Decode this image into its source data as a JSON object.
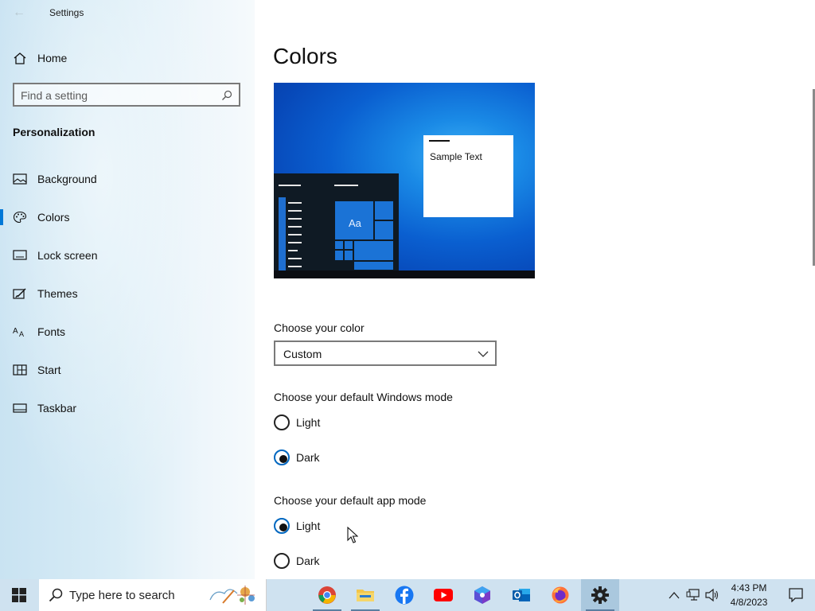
{
  "window": {
    "app_title": "Settings",
    "back_glyph": "←"
  },
  "sidebar": {
    "home_label": "Home",
    "search_placeholder": "Find a setting",
    "section_title": "Personalization",
    "items": [
      {
        "label": "Background",
        "icon": "image-icon"
      },
      {
        "label": "Colors",
        "icon": "palette-icon",
        "selected": true
      },
      {
        "label": "Lock screen",
        "icon": "lock-screen-icon"
      },
      {
        "label": "Themes",
        "icon": "themes-brush-icon"
      },
      {
        "label": "Fonts",
        "icon": "fonts-icon"
      },
      {
        "label": "Start",
        "icon": "start-grid-icon"
      },
      {
        "label": "Taskbar",
        "icon": "taskbar-icon"
      }
    ]
  },
  "main": {
    "title": "Colors",
    "preview": {
      "sample_text": "Sample Text",
      "tile_text": "Aa"
    },
    "choose_color": {
      "label": "Choose your color",
      "value": "Custom"
    },
    "windows_mode": {
      "label": "Choose your default Windows mode",
      "options": [
        "Light",
        "Dark"
      ],
      "selected": "Dark"
    },
    "app_mode": {
      "label": "Choose your default app mode",
      "options": [
        "Light",
        "Dark"
      ],
      "selected": "Light"
    }
  },
  "taskbar": {
    "search_placeholder": "Type here to search",
    "apps": [
      "chrome-icon",
      "file-explorer-icon",
      "facebook-icon",
      "youtube-icon",
      "app-cube-icon",
      "outlook-icon",
      "firefox-icon",
      "settings-gear-icon"
    ],
    "active_app": "settings-gear-icon",
    "time": "4:43 PM",
    "date": "4/8/2023"
  },
  "colors": {
    "accent": "#0078d7",
    "taskbar_bg": "#cfe2f0",
    "sidebar_bg": "#d8ecf6"
  }
}
